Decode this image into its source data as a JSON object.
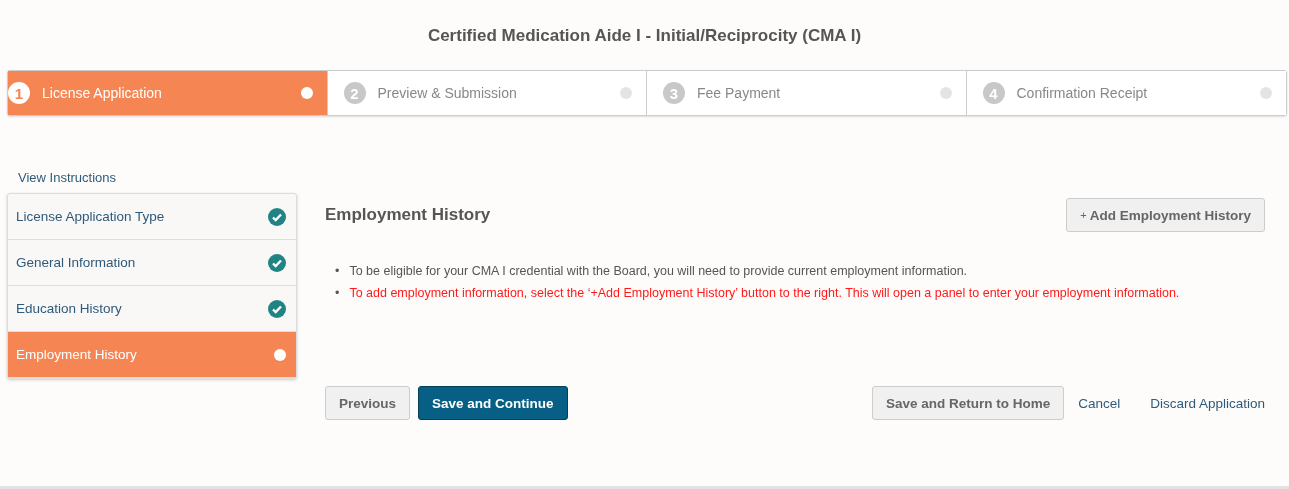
{
  "title": "Certified Medication Aide I - Initial/Reciprocity (CMA I)",
  "steps": [
    {
      "number": "1",
      "label": "License Application",
      "selected": true
    },
    {
      "number": "2",
      "label": "Preview & Submission",
      "selected": false
    },
    {
      "number": "3",
      "label": "Fee Payment",
      "selected": false
    },
    {
      "number": "4",
      "label": "Confirmation Receipt",
      "selected": false
    }
  ],
  "sidebar": {
    "instructions_link": "View Instructions",
    "items": [
      {
        "label": "License Application Type",
        "selected": false,
        "completed": true
      },
      {
        "label": "General Information",
        "selected": false,
        "completed": true
      },
      {
        "label": "Education History",
        "selected": false,
        "completed": true
      },
      {
        "label": "Employment History",
        "selected": true,
        "completed": false
      }
    ]
  },
  "section": {
    "heading": "Employment History",
    "add_button": {
      "icon": "+",
      "label": "Add Employment History"
    },
    "notes": [
      {
        "marker": "•",
        "text": "To be eligible for your CMA I credential with the Board, you will need to provide current employment information.",
        "kind": "info"
      },
      {
        "marker": "•",
        "text": "To add employment information, select the ‘+Add Employment History’ button to the right. This will open a panel to enter your employment information.",
        "kind": "warning"
      }
    ]
  },
  "actions": {
    "previous": "Previous",
    "save_continue": "Save and Continue",
    "save_return": "Save and Return to Home",
    "cancel": "Cancel",
    "discard": "Discard Application"
  }
}
